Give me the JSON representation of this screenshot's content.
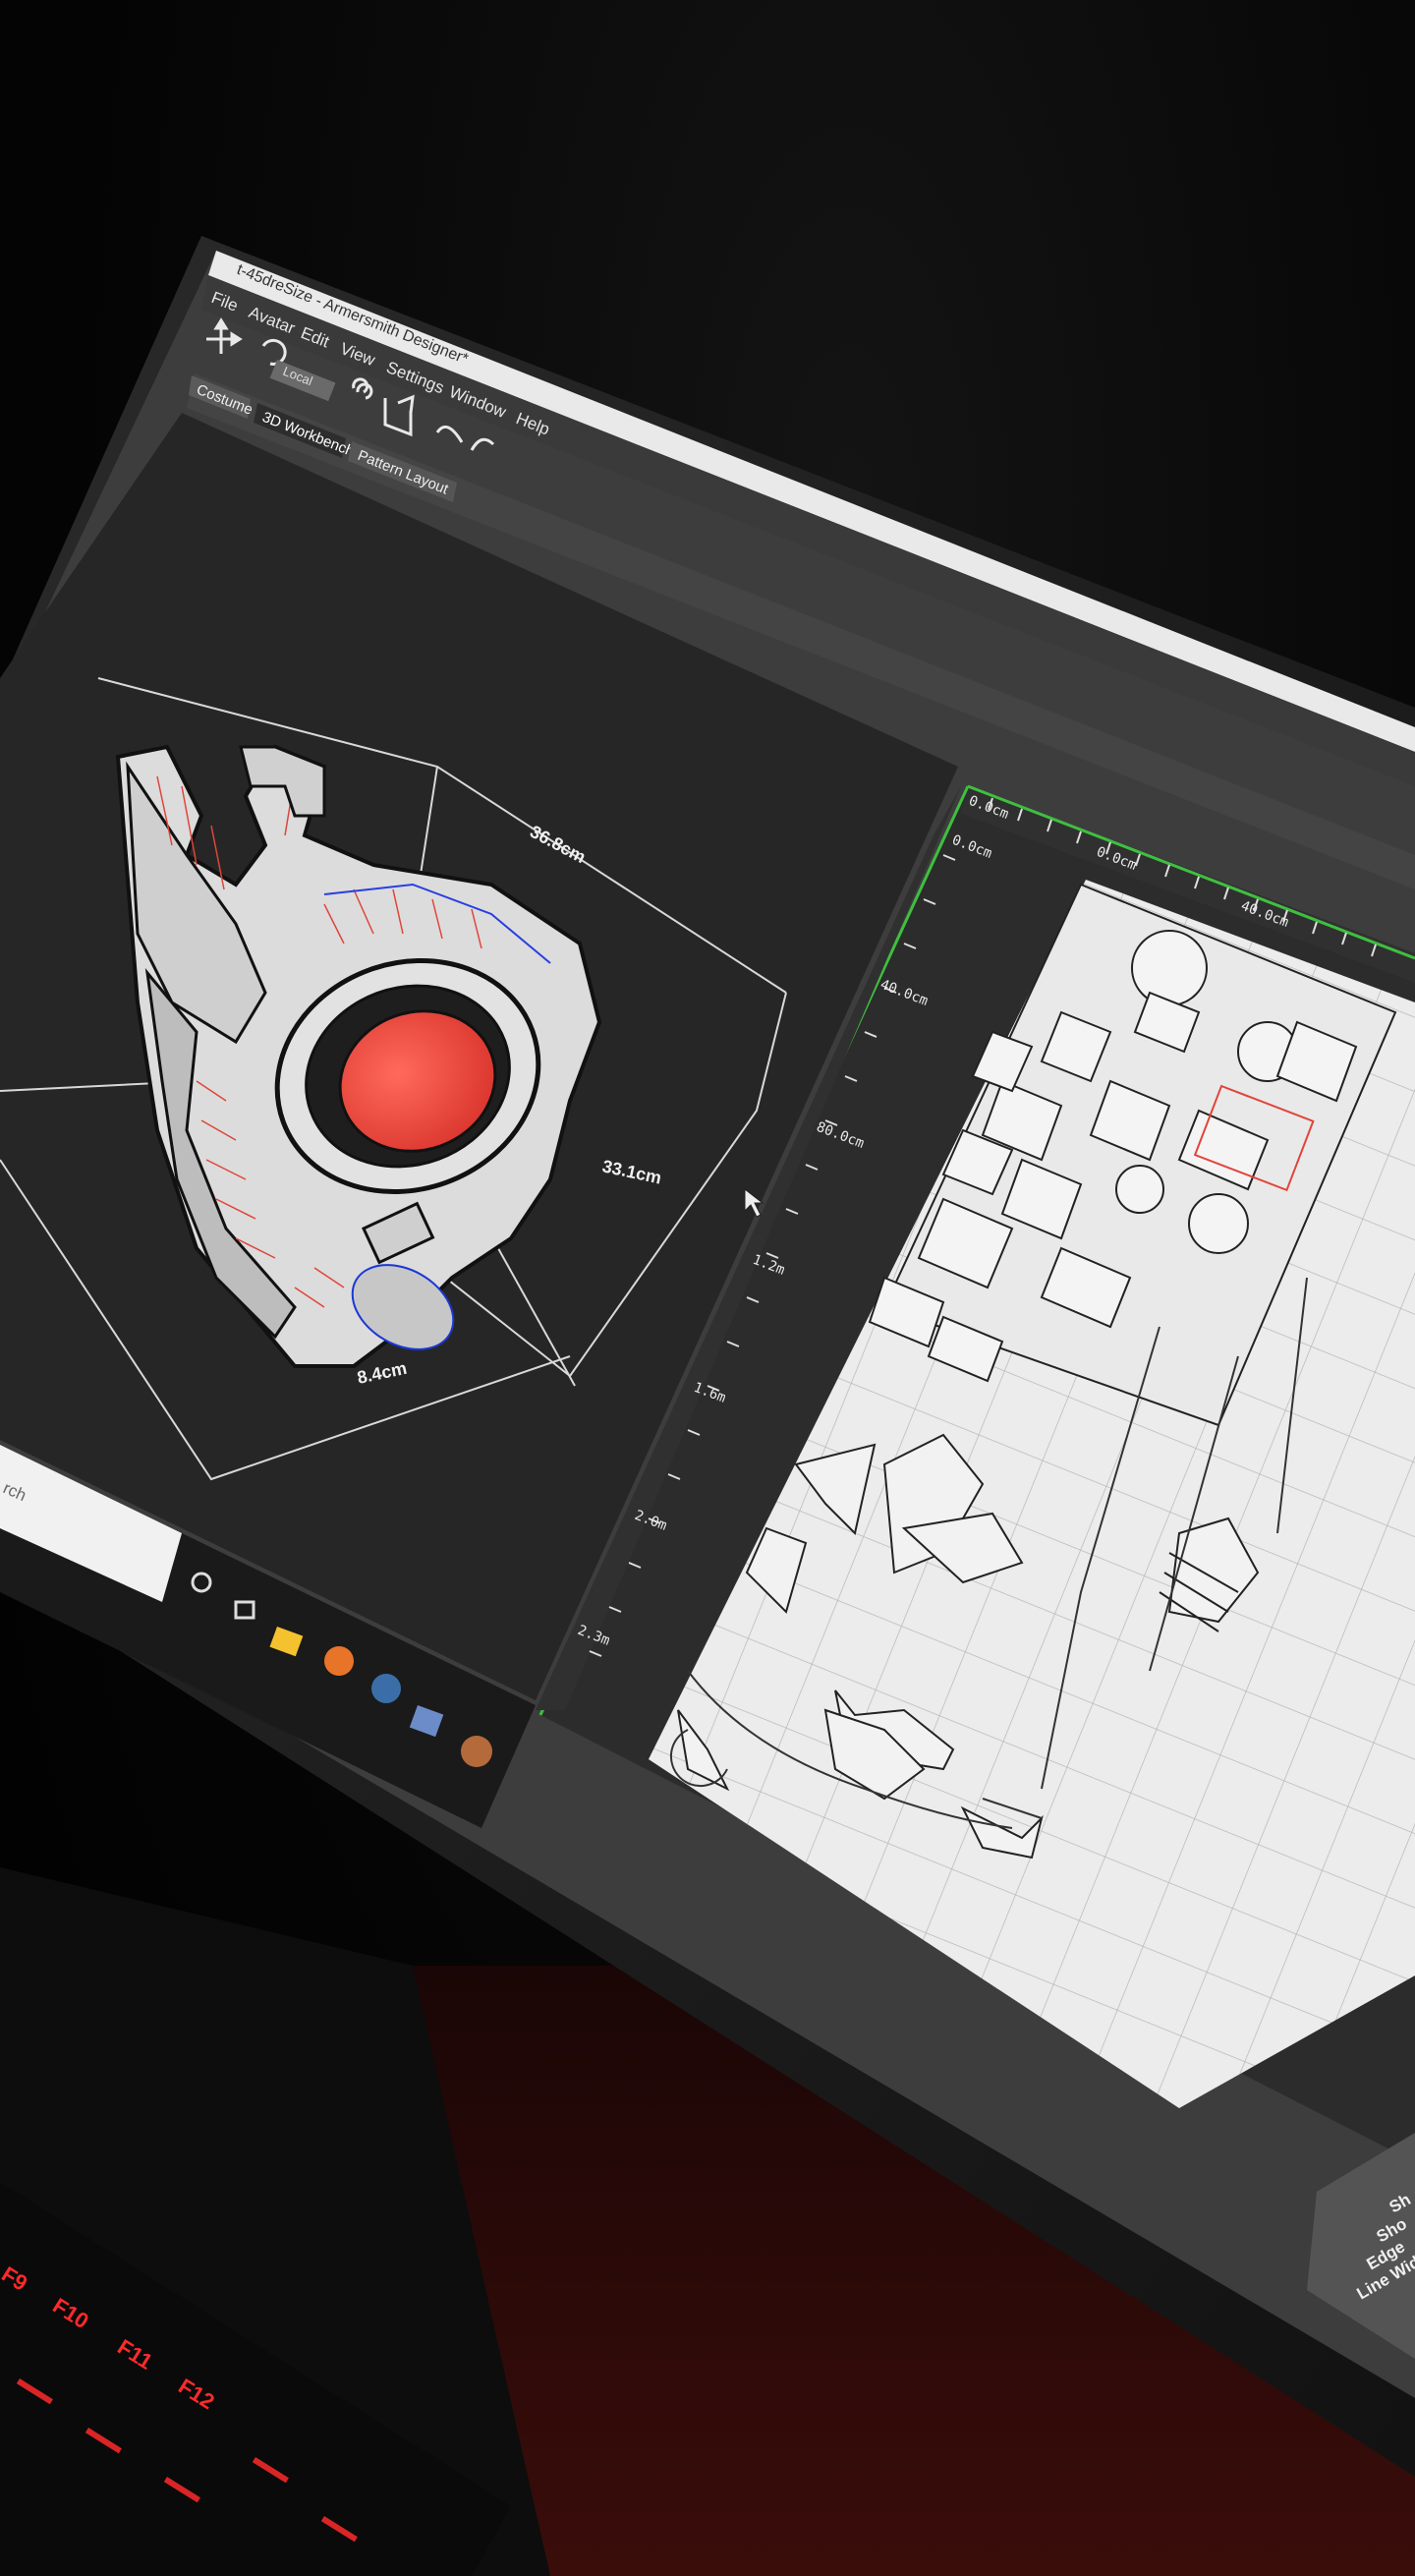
{
  "window": {
    "title": "t-45dreSize - Armersmith Designer*"
  },
  "menu": [
    "File",
    "Avatar",
    "Edit",
    "View",
    "Settings",
    "Window",
    "Help"
  ],
  "toolbar": {
    "space_label": "Local"
  },
  "tabs": [
    {
      "label": "Costume"
    },
    {
      "label": "3D Workbench",
      "active": true
    },
    {
      "label": "Pattern Layout"
    }
  ],
  "viewport3d": {
    "dimensions": {
      "width": "36.8cm",
      "height": "33.1cm",
      "depth": "8.4cm"
    }
  },
  "pattern_panel": {
    "ruler_top": [
      "0.0cm",
      "0.0cm",
      "40.0cm"
    ],
    "ruler_left": [
      "0.0cm",
      "40.0cm",
      "80.0cm",
      "1.2m",
      "1.6m",
      "2.0m",
      "2.3m"
    ]
  },
  "properties_panel": {
    "rows": [
      "Sh",
      "Sho",
      "Edge",
      "Line Wid"
    ]
  },
  "taskbar": {
    "search_placeholder": "rch"
  },
  "keyboard": {
    "keys": [
      "F9",
      "F10",
      "F11",
      "F12"
    ]
  },
  "colors": {
    "accent_green": "#3fbf3f",
    "model_red": "#e8453a",
    "keyboard_red": "#ff2a2a",
    "viewport_bg": "#262626",
    "pattern_bg": "#ececec"
  }
}
